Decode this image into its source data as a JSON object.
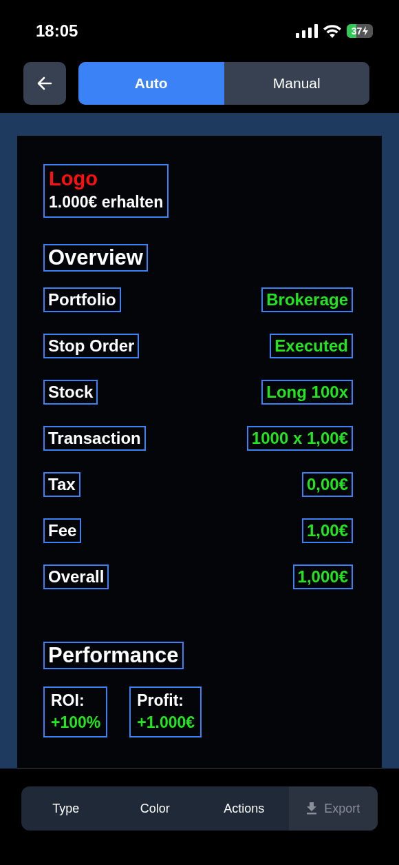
{
  "status_bar": {
    "time": "18:05",
    "battery": "37"
  },
  "header": {
    "tabs": [
      {
        "label": "Auto",
        "selected": true
      },
      {
        "label": "Manual",
        "selected": false
      }
    ]
  },
  "card": {
    "logo": "Logo",
    "bonus": "1.000€ erhalten",
    "overview_title": "Overview",
    "rows": [
      {
        "label": "Portfolio",
        "value": "Brokerage"
      },
      {
        "label": "Stop Order",
        "value": "Executed"
      },
      {
        "label": "Stock",
        "value": "Long 100x"
      },
      {
        "label": "Transaction",
        "value": "1000 x 1,00€"
      },
      {
        "label": "Tax",
        "value": "0,00€"
      },
      {
        "label": "Fee",
        "value": "1,00€"
      },
      {
        "label": "Overall",
        "value": "1,000€"
      }
    ],
    "performance_title": "Performance",
    "metrics": [
      {
        "label": "ROI:",
        "value": "+100%"
      },
      {
        "label": "Profit:",
        "value": "+1.000€"
      }
    ]
  },
  "toolbar": [
    {
      "label": "Type",
      "disabled": false
    },
    {
      "label": "Color",
      "disabled": false
    },
    {
      "label": "Actions",
      "disabled": false
    },
    {
      "label": "Export",
      "disabled": true
    }
  ]
}
